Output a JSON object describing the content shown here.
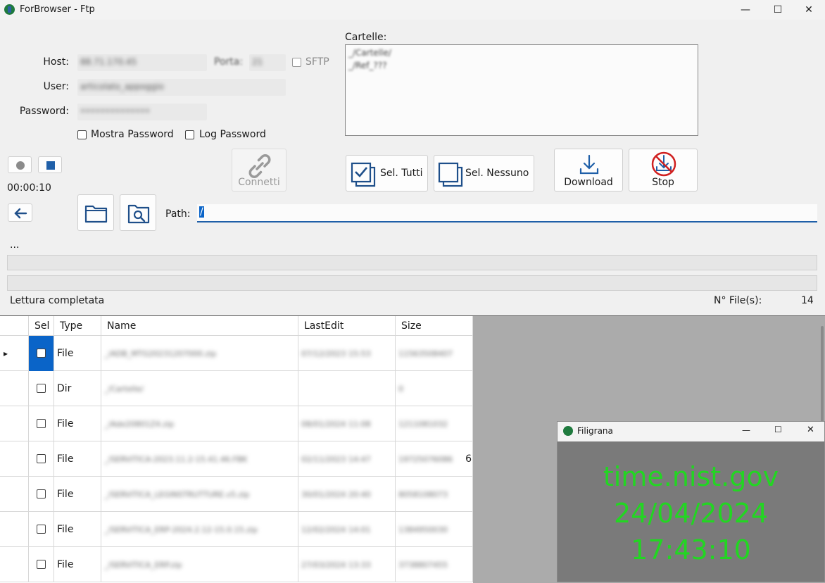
{
  "window": {
    "title": "ForBrowser - Ftp",
    "min": "—",
    "max": "☐",
    "close": "✕"
  },
  "form": {
    "host_label": "Host:",
    "host_value": "88.71.170.45",
    "port_label": "Porta:",
    "port_value": "21",
    "sftp_label": "SFTP",
    "user_label": "User:",
    "user_value": "articolato_appoggio",
    "password_label": "Password:",
    "password_value": "••••••••••••••",
    "show_password": "Mostra Password",
    "log_password": "Log Password"
  },
  "folders": {
    "label": "Cartelle:",
    "items": [
      "_/Cartelle/",
      "_/Ref_???"
    ]
  },
  "toolbar": {
    "connect": "Connetti",
    "select_all": "Sel. Tutti",
    "select_none": "Sel. Nessuno",
    "download": "Download",
    "stop": "Stop"
  },
  "timer": "00:00:10",
  "path": {
    "label": "Path:",
    "value": "/"
  },
  "dots": "...",
  "status": {
    "text": "Lettura completata",
    "files_label": "N° File(s):",
    "files_count": "14"
  },
  "grid": {
    "headers": [
      "Sel",
      "Type",
      "Name",
      "LastEdit",
      "Size"
    ],
    "rows": [
      {
        "type": "File",
        "name": "_/ADB_MTG20231207000.zip",
        "lastedit": "07/12/2023 15:53",
        "size": "11563508407"
      },
      {
        "type": "Dir",
        "name": "_/Cartelle/",
        "lastedit": "",
        "size": "0"
      },
      {
        "type": "File",
        "name": "_/Ade20801Z4.zip",
        "lastedit": "08/01/2024 11:08",
        "size": "1211081032"
      },
      {
        "type": "File",
        "name": "_/SERVITICA-2023.11.2-15.41.46.FBK",
        "lastedit": "02/11/2023 14:47",
        "size": "19725076086",
        "extra": "6"
      },
      {
        "type": "File",
        "name": "_/SERVITICA_LEGINSTRUTTURE.v5.zip",
        "lastedit": "30/01/2024 20:40",
        "size": "8058108073"
      },
      {
        "type": "File",
        "name": "_/SERVITICA_ERP-2024.2.12-15.0.15.zip",
        "lastedit": "12/02/2024 14:01",
        "size": "1384950030"
      },
      {
        "type": "File",
        "name": "_/SERVITICA_ERP.zip",
        "lastedit": "27/03/2024 13:33",
        "size": "3738807455"
      }
    ]
  },
  "filigrana": {
    "title": "Filigrana",
    "line1": "time.nist.gov",
    "line2": "24/04/2024",
    "line3": "17:43:10"
  },
  "colors": {
    "accent": "#1f5fa8",
    "filigrana_text": "#22d622",
    "stop_red": "#d02020"
  }
}
